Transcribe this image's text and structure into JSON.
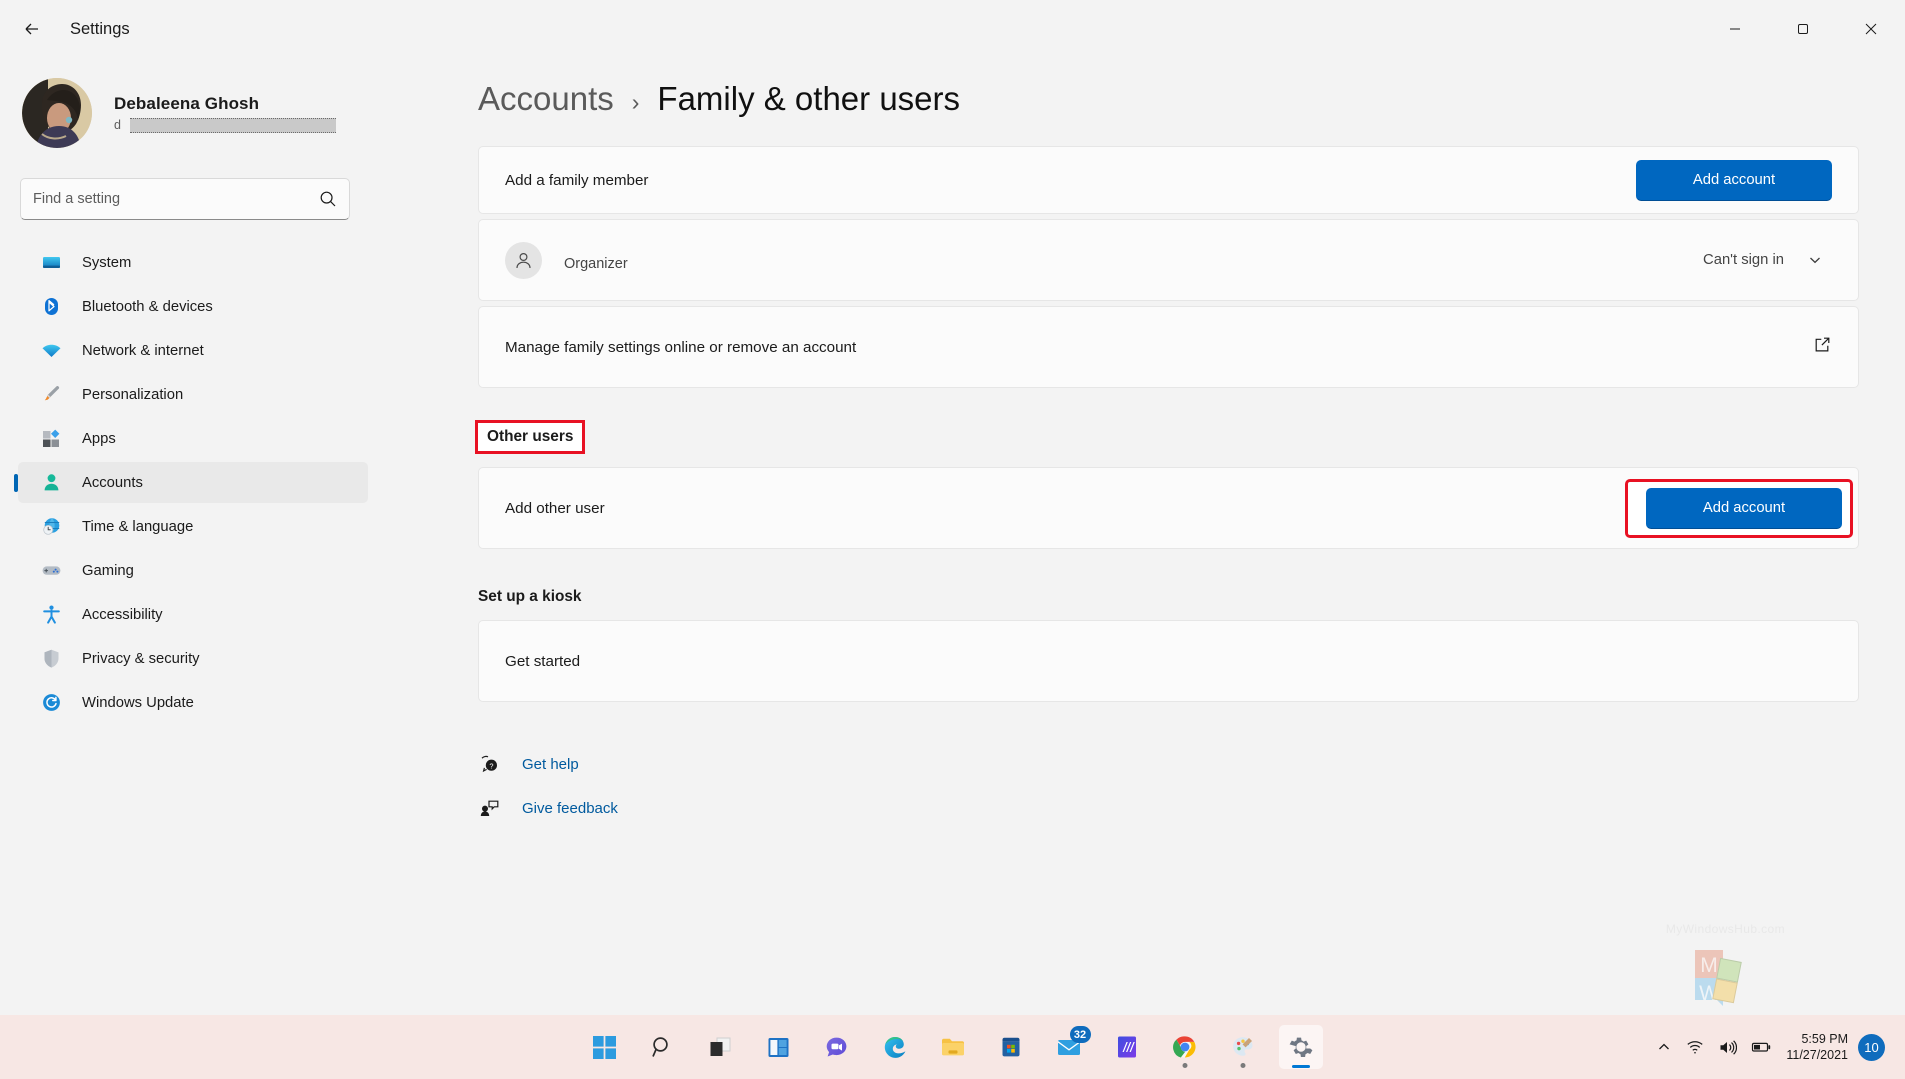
{
  "window": {
    "title": "Settings",
    "back_label": "Back",
    "minimize_label": "Minimize",
    "maximize_label": "Restore",
    "close_label": "Close"
  },
  "profile": {
    "name": "Debaleena Ghosh",
    "email_prefix": "d",
    "email_redacted": true
  },
  "search": {
    "placeholder": "Find a setting",
    "value": ""
  },
  "sidebar": {
    "items": [
      {
        "label": "System",
        "icon": "display-icon",
        "active": false
      },
      {
        "label": "Bluetooth & devices",
        "icon": "bluetooth-icon",
        "active": false
      },
      {
        "label": "Network & internet",
        "icon": "wifi-icon",
        "active": false
      },
      {
        "label": "Personalization",
        "icon": "paintbrush-icon",
        "active": false
      },
      {
        "label": "Apps",
        "icon": "apps-icon",
        "active": false
      },
      {
        "label": "Accounts",
        "icon": "person-icon",
        "active": true
      },
      {
        "label": "Time & language",
        "icon": "clock-globe-icon",
        "active": false
      },
      {
        "label": "Gaming",
        "icon": "gamepad-icon",
        "active": false
      },
      {
        "label": "Accessibility",
        "icon": "accessibility-icon",
        "active": false
      },
      {
        "label": "Privacy & security",
        "icon": "shield-icon",
        "active": false
      },
      {
        "label": "Windows Update",
        "icon": "update-icon",
        "active": false
      }
    ]
  },
  "breadcrumb": {
    "parent": "Accounts",
    "separator": "›",
    "current": "Family & other users"
  },
  "main": {
    "family": {
      "add_member_label": "Add a family member",
      "add_member_button": "Add account",
      "member": {
        "name_redacted": true,
        "role": "Organizer",
        "status": "Can't sign in",
        "expand_icon": "chevron-down-icon"
      },
      "manage_label": "Manage family settings online or remove an account",
      "manage_icon": "external-link-icon"
    },
    "other_users": {
      "heading": "Other users",
      "add_other_label": "Add other user",
      "add_other_button": "Add account"
    },
    "kiosk": {
      "heading": "Set up a kiosk",
      "get_started_label": "Get started"
    },
    "links": [
      {
        "label": "Get help",
        "icon": "help-icon"
      },
      {
        "label": "Give feedback",
        "icon": "feedback-icon"
      }
    ]
  },
  "watermark": {
    "text": "MyWindowsHub.com",
    "logo_top": "M",
    "logo_bottom": "W"
  },
  "taskbar": {
    "items": [
      {
        "name": "start",
        "label": "Start",
        "badge": "",
        "running": false,
        "active": false
      },
      {
        "name": "search",
        "label": "Search",
        "badge": "",
        "running": false,
        "active": false
      },
      {
        "name": "task-view",
        "label": "Task View",
        "badge": "",
        "running": false,
        "active": false
      },
      {
        "name": "widgets",
        "label": "Widgets",
        "badge": "",
        "running": false,
        "active": false
      },
      {
        "name": "chat",
        "label": "Chat",
        "badge": "",
        "running": false,
        "active": false
      },
      {
        "name": "edge",
        "label": "Microsoft Edge",
        "badge": "",
        "running": false,
        "active": false
      },
      {
        "name": "file-explorer",
        "label": "File Explorer",
        "badge": "",
        "running": false,
        "active": false
      },
      {
        "name": "microsoft-store",
        "label": "Microsoft Store",
        "badge": "",
        "running": false,
        "active": false
      },
      {
        "name": "mail",
        "label": "Mail",
        "badge": "32",
        "running": false,
        "active": false
      },
      {
        "name": "movies-anywhere",
        "label": "Movies",
        "badge": "",
        "running": false,
        "active": false
      },
      {
        "name": "chrome",
        "label": "Google Chrome",
        "badge": "",
        "running": true,
        "active": false
      },
      {
        "name": "paint",
        "label": "Paint",
        "badge": "",
        "running": true,
        "active": false
      },
      {
        "name": "settings",
        "label": "Settings",
        "badge": "",
        "running": true,
        "active": true
      }
    ],
    "tray": {
      "show_hidden_icons": "show-hidden-icons",
      "network": "wifi-icon",
      "volume": "volume-icon",
      "battery": "battery-icon",
      "time": "5:59 PM",
      "date": "11/27/2021",
      "notification_count": "10"
    }
  },
  "colors": {
    "accent": "#0067c0",
    "annotation": "#e81123",
    "link": "#005a9e",
    "sidebar_bg": "#f3f3f3",
    "card_bg": "#fbfbfb",
    "taskbar_bg": "#f7e7e4"
  }
}
